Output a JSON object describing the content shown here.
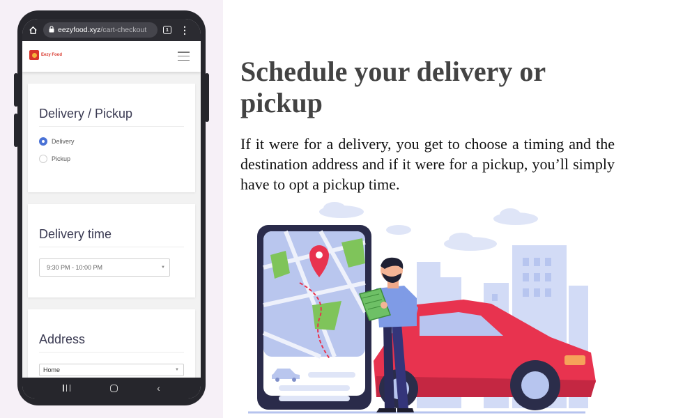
{
  "browser": {
    "url_domain": "eezyfood.xyz",
    "url_path": "/cart-checkout",
    "tab_count": "1"
  },
  "app": {
    "logo_text": "Eezy Food"
  },
  "checkout": {
    "delivery_pickup": {
      "title": "Delivery / Pickup",
      "options": [
        {
          "label": "Delivery",
          "selected": true
        },
        {
          "label": "Pickup",
          "selected": false
        }
      ]
    },
    "delivery_time": {
      "title": "Delivery time",
      "selected": "9:30 PM - 10:00 PM"
    },
    "address": {
      "title": "Address",
      "selected": "Home"
    }
  },
  "promo": {
    "headline": "Schedule your delivery or pickup",
    "body": "If it were for a delivery, you get to choose a timing and the destination address and if it were for a pickup, you’ll simply have to opt a pickup time."
  },
  "colors": {
    "accent_blue": "#4a72d6",
    "car_red": "#e8334f",
    "phone_frame": "#26262c",
    "map_green": "#7fc45a",
    "map_blue": "#b9c6ee"
  },
  "icons": [
    "home-icon",
    "lock-icon",
    "tabs-icon",
    "kebab-icon",
    "hamburger-icon",
    "dropdown-caret-icon",
    "location-pin-icon",
    "car-icon"
  ]
}
